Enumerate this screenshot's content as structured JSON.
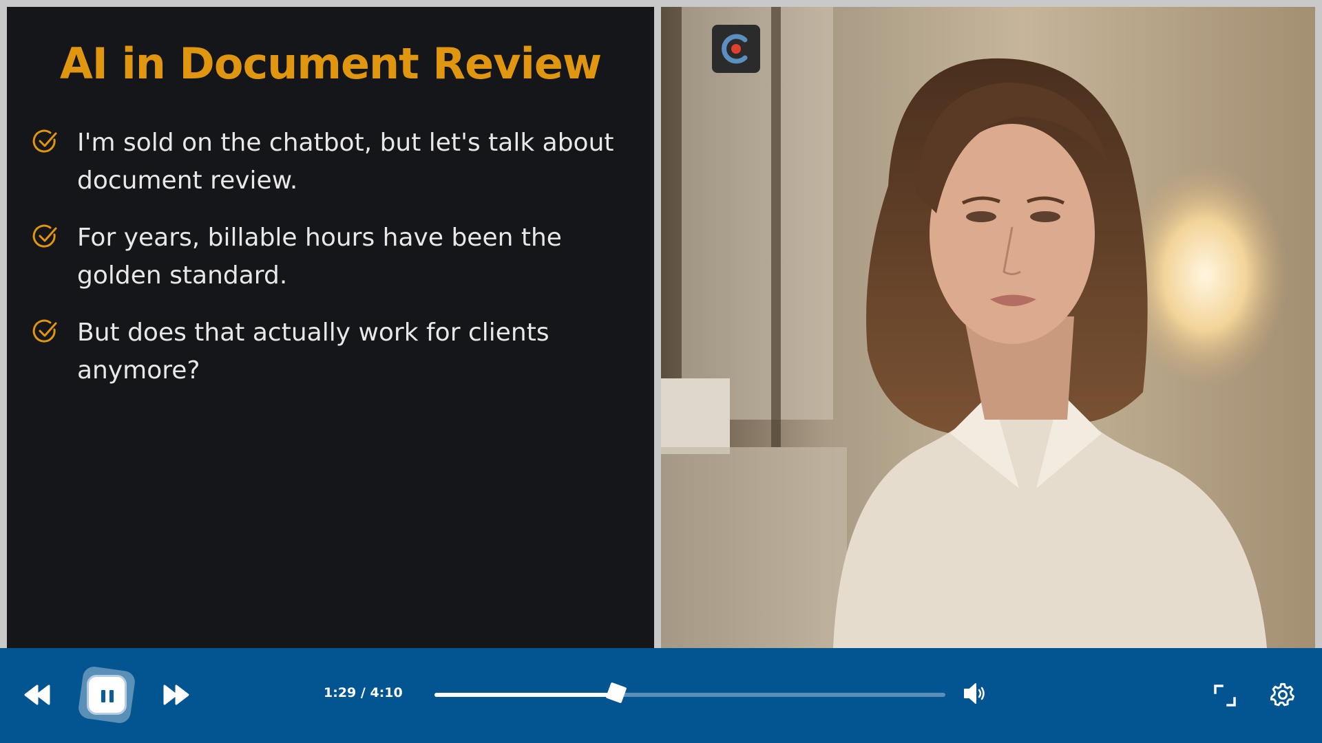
{
  "slide": {
    "title": "AI in Document Review",
    "bullets": [
      {
        "line1": "I'm sold on the chatbot, but let's talk about",
        "line2": "document review."
      },
      {
        "line1": "For years, billable hours have been the",
        "line2": "golden standard."
      },
      {
        "line1": "But does that actually work for clients",
        "line2": "anymore?"
      }
    ],
    "accent_color": "#e0960f"
  },
  "video": {
    "channel_logo_icon": "c-logo-icon"
  },
  "player": {
    "time_current": "1:29",
    "time_separator": "/",
    "time_total": "4:10",
    "progress_fraction": 0.356,
    "bar_color": "#035591",
    "icons": {
      "rewind": "rewind-icon",
      "pause": "pause-icon",
      "forward": "fast-forward-icon",
      "volume": "volume-icon",
      "fullscreen": "fullscreen-icon",
      "settings": "gear-icon"
    }
  }
}
